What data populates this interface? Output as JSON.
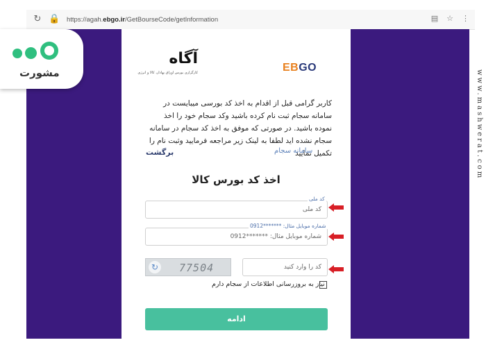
{
  "browser": {
    "url_prefix": "https://agah.",
    "url_domain": "ebgo.ir",
    "url_path": "/GetBourseCode/getInformation"
  },
  "branding": {
    "mashwerat_logo_text": "مشورت",
    "side_text": "www.mashwerat.com",
    "ebgo_part1": "EB",
    "ebgo_part2": "GO",
    "agah_logo_text": "آگاه",
    "agah_tagline": "کارگزاری بورس اوراق بهادار، کالا و انرژی"
  },
  "intro": {
    "text": "کاربر گرامی قبل از اقدام به اخذ کد بورسی میبایست در سامانه سجام ثبت نام کرده باشید وکد سجام خود را اخذ نموده باشید. در صورتی که موفق به اخذ کد سجام در سامانه سجام نشده اید لطفا به لینک زیر مراجعه فرمایید وثبت نام را تکمیل نمایید",
    "sajam_link": "سامانه سجام",
    "back_link": "برگشت"
  },
  "form": {
    "title": "اخذ کد بورس کالا",
    "national_code": {
      "label": "کد ملی",
      "placeholder": "کد ملی"
    },
    "mobile": {
      "label": "شماره موبایل مثال: *******0912",
      "placeholder": "شماره موبایل مثال: *******0912"
    },
    "captcha": {
      "placeholder": "کد را وارد کنید",
      "image_text": "77504"
    },
    "sajam_update_checkbox": "نیاز به بروزرسانی اطلاعات از سجام دارم",
    "continue_button": "ادامه"
  },
  "colors": {
    "backdrop": "#3b1a7e",
    "accent_button": "#48c09e",
    "arrow": "#d81f26"
  }
}
